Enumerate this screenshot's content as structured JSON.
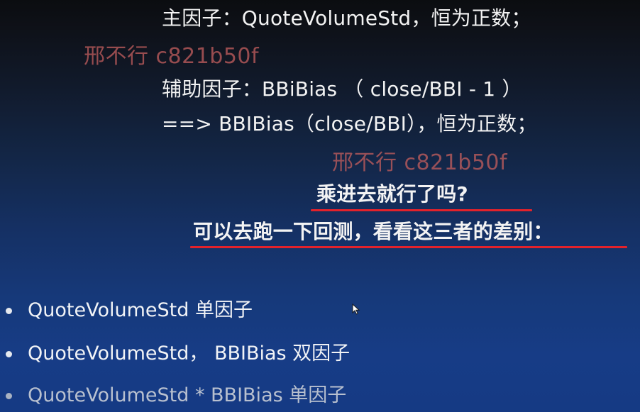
{
  "slide": {
    "lines": {
      "main_factor": "主因子：QuoteVolumeStd，恒为正数；",
      "aux_factor": "辅助因子：BBiBias （ close/BBI - 1 ）",
      "arrow_line": "==> BBIBias（close/BBI），恒为正数；",
      "question": "乘进去就行了吗?",
      "backtest": "可以去跑一下回测，看看这三者的差别："
    },
    "watermarks": [
      "邢不行 c821b50f",
      "邢不行 c821b50f"
    ],
    "bullets": [
      "QuoteVolumeStd 单因子",
      "QuoteVolumeStd， BBIBias 双因子",
      "QuoteVolumeStd * BBIBias 单因子"
    ]
  },
  "colors": {
    "underline": "#e3222b",
    "watermark": "#be5c5c",
    "text": "#f3f3f3"
  },
  "icons": {
    "cursor": "mouse-pointer-icon"
  }
}
